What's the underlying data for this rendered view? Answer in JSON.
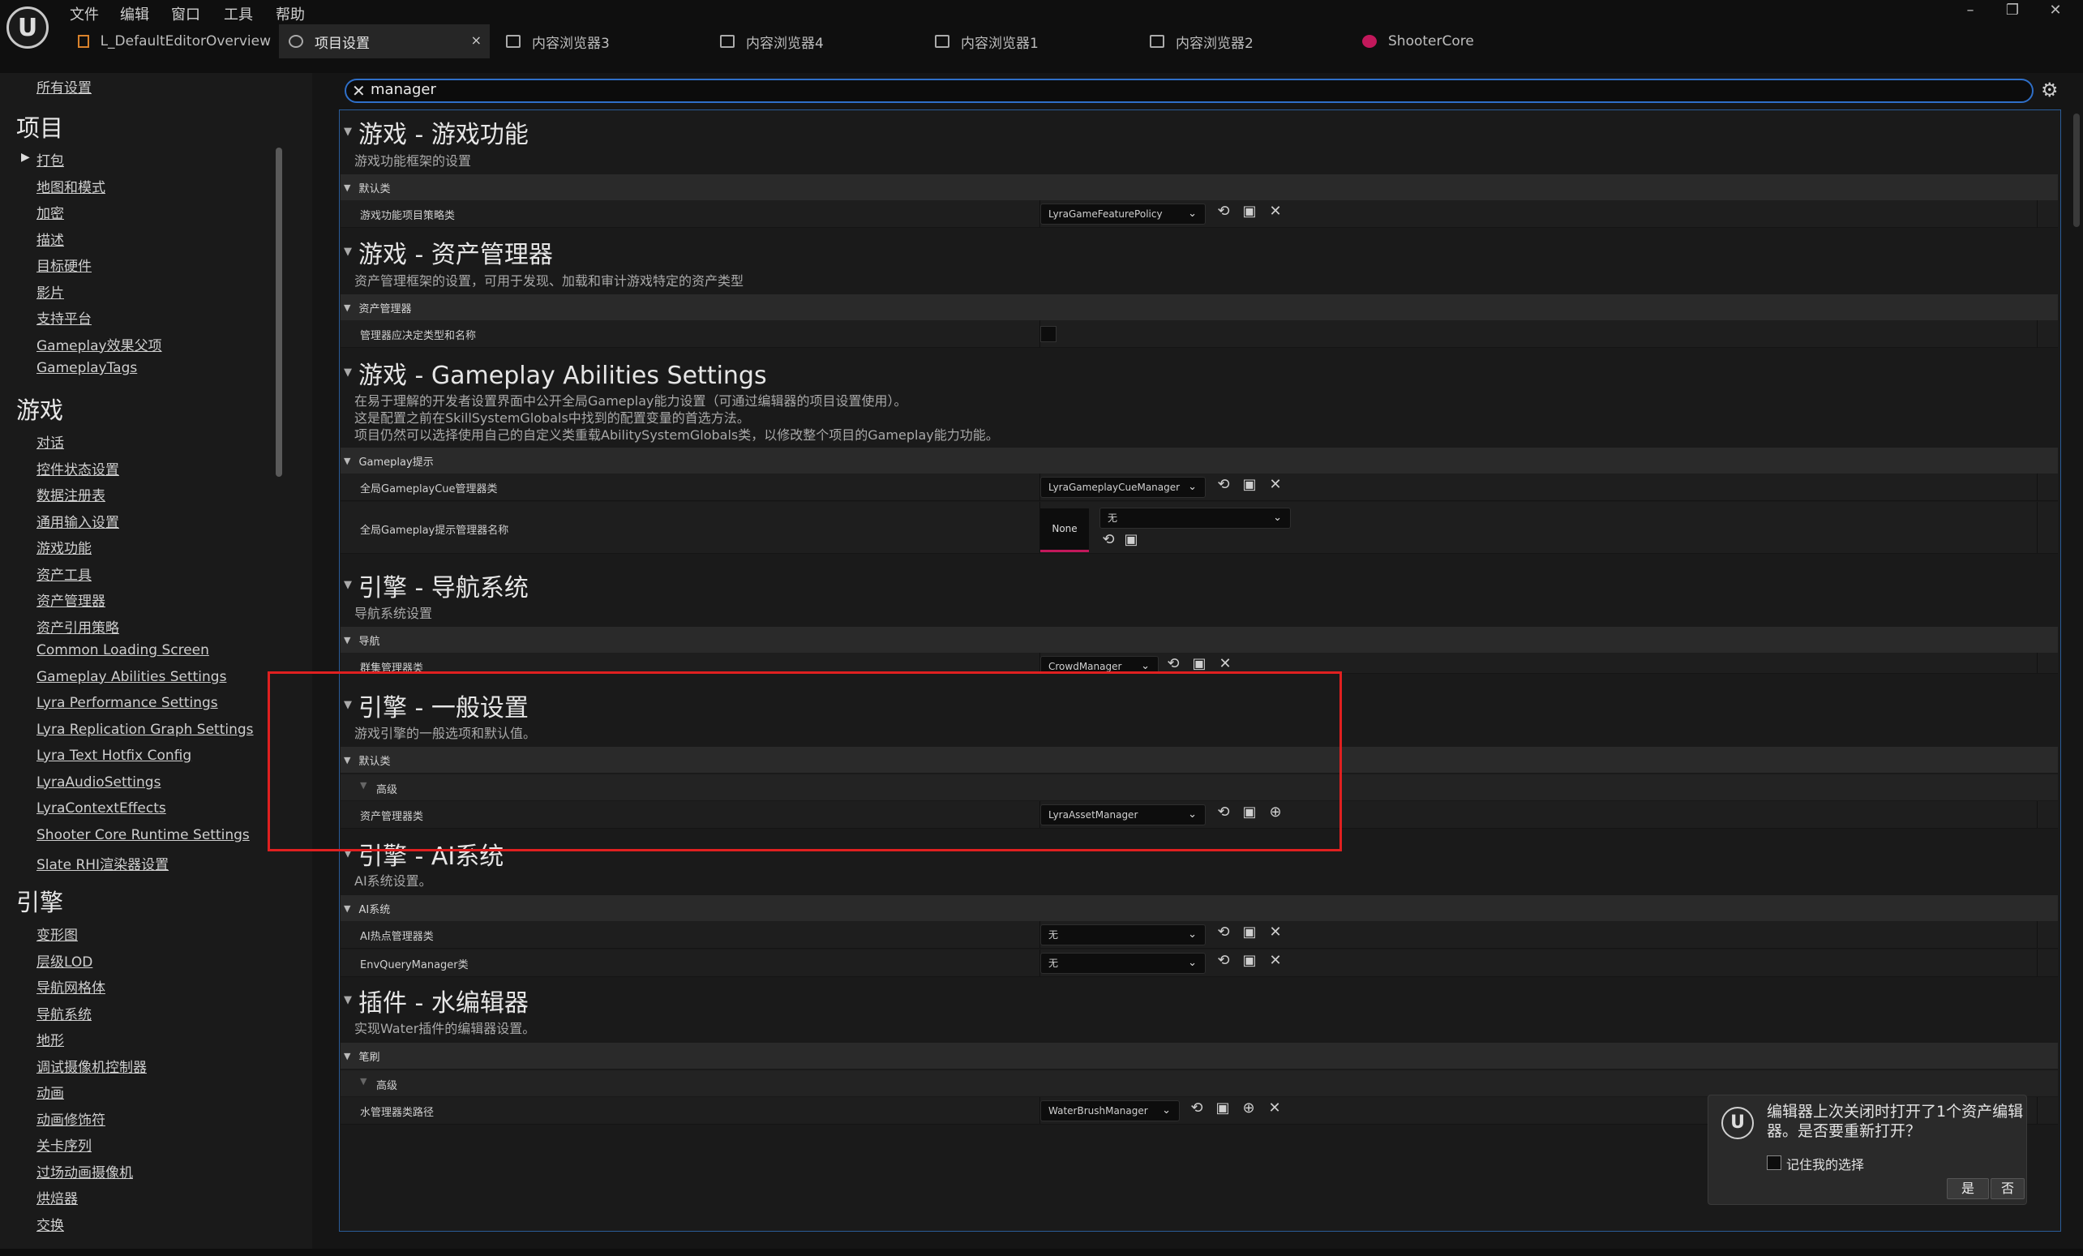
{
  "menubar": {
    "items": [
      "文件",
      "编辑",
      "窗口",
      "工具",
      "帮助"
    ]
  },
  "tabs": [
    {
      "label": "L_DefaultEditorOverview",
      "icon": "level-icon"
    },
    {
      "label": "项目设置",
      "icon": "settings-icon",
      "active": true,
      "close": "×"
    },
    {
      "label": "内容浏览器3",
      "icon": "content-browser-icon"
    },
    {
      "label": "内容浏览器4",
      "icon": "content-browser-icon"
    },
    {
      "label": "内容浏览器1",
      "icon": "content-browser-icon"
    },
    {
      "label": "内容浏览器2",
      "icon": "content-browser-icon"
    },
    {
      "label": "ShooterCore",
      "icon": "plugin-icon"
    }
  ],
  "window_buttons": {
    "minimize": "–",
    "restore": "❐",
    "close": "✕"
  },
  "sidebar": {
    "all": "所有设置",
    "project_head": "项目",
    "project_items": [
      "打包",
      "地图和模式",
      "加密",
      "描述",
      "目标硬件",
      "影片",
      "支持平台",
      "Gameplay效果父项",
      "GameplayTags"
    ],
    "game_head": "游戏",
    "game_items": [
      "对话",
      "控件状态设置",
      "数据注册表",
      "通用输入设置",
      "游戏功能",
      "资产工具",
      "资产管理器",
      "资产引用策略",
      "Common Loading Screen",
      "Gameplay Abilities Settings",
      "Lyra Performance Settings",
      "Lyra Replication Graph Settings",
      "Lyra Text Hotfix Config",
      "LyraAudioSettings",
      "LyraContextEffects",
      "Shooter Core Runtime Settings",
      "Slate RHI渲染器设置"
    ],
    "engine_head": "引擎",
    "engine_items": [
      "变形图",
      "层级LOD",
      "导航网格体",
      "导航系统",
      "地形",
      "调试摄像机控制器",
      "动画",
      "动画修饰符",
      "关卡序列",
      "过场动画摄像机",
      "烘焙器",
      "交换"
    ]
  },
  "search": {
    "value": "manager",
    "clear": "✕",
    "settings": "⚙"
  },
  "sections": {
    "s1": {
      "title": "游戏 - 游戏功能",
      "desc": "游戏功能框架的设置",
      "cat": "默认类",
      "row1": {
        "label": "游戏功能项目策略类",
        "value": "LyraGameFeaturePolicy"
      }
    },
    "s2": {
      "title": "游戏 - 资产管理器",
      "desc": "资产管理框架的设置，可用于发现、加载和审计游戏特定的资产类型",
      "cat": "资产管理器",
      "row1": {
        "label": "管理器应决定类型和名称"
      }
    },
    "s3": {
      "title": "游戏 - Gameplay Abilities Settings",
      "desc1": "在易于理解的开发者设置界面中公开全局Gameplay能力设置（可通过编辑器的项目设置使用）。",
      "desc2": "这是配置之前在SkillSystemGlobals中找到的配置变量的首选方法。",
      "desc3": "项目仍然可以选择使用自己的自定义类重载AbilitySystemGlobals类，以修改整个项目的Gameplay能力功能。",
      "cat": "Gameplay提示",
      "row1": {
        "label": "全局GameplayCue管理器类",
        "value": "LyraGameplayCueManager"
      },
      "row2": {
        "label": "全局Gameplay提示管理器名称",
        "swatch": "None",
        "value": "无"
      }
    },
    "s4": {
      "title": "引擎 - 导航系统",
      "desc": "导航系统设置",
      "cat": "导航",
      "row1": {
        "label": "群集管理器类",
        "value": "CrowdManager"
      }
    },
    "s5": {
      "title": "引擎 - 一般设置",
      "desc": "游戏引擎的一般选项和默认值。",
      "cat": "默认类",
      "sub": "高级",
      "row1": {
        "label": "资产管理器类",
        "value": "LyraAssetManager"
      }
    },
    "s6": {
      "title": "引擎 - AI系统",
      "desc": "AI系统设置。",
      "cat": "AI系统",
      "row1": {
        "label": "AI热点管理器类",
        "value": "无"
      },
      "row2": {
        "label": "EnvQueryManager类",
        "value": "无"
      }
    },
    "s7": {
      "title": "插件 - 水编辑器",
      "desc": "实现Water插件的编辑器设置。",
      "cat": "笔刷",
      "sub": "高级",
      "row1": {
        "label": "水管理器类路径",
        "value": "WaterBrushManager"
      }
    }
  },
  "dialog": {
    "text": "编辑器上次关闭时打开了1个资产编辑器。是否要重新打开？",
    "remember": "记住我的选择",
    "yes": "是",
    "no": "否"
  },
  "colors": {
    "highlight": "#e02020",
    "accent": "#2f6fc8",
    "swatch_underline": "#c2185b"
  }
}
